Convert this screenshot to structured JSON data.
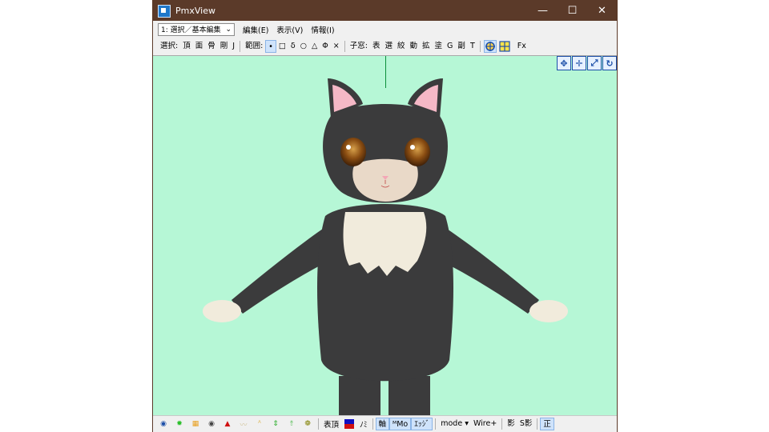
{
  "window": {
    "title": "PmxView",
    "minimize": "—",
    "maximize": "☐",
    "close": "✕"
  },
  "menubar": {
    "mode_value": "1: 選択／基本編集",
    "items": [
      "編集(E)",
      "表示(V)",
      "情報(I)"
    ]
  },
  "toolbar": {
    "select_label": "選択:",
    "select_items": [
      "頂",
      "面",
      "骨",
      "剛",
      "J"
    ],
    "range_label": "範囲:",
    "range_items": [
      "•",
      "□",
      "δ",
      "○",
      "△",
      "Φ",
      "×"
    ],
    "child_label": "子窓:",
    "child_items": [
      "表",
      "選",
      "絞",
      "動",
      "拡",
      "塗",
      "G",
      "副",
      "T"
    ],
    "fx_label": "Fx"
  },
  "statusbar": {
    "table_label": "表頂",
    "mi_label": "ﾉﾐ",
    "axis_label": "軸",
    "mo_label": "ᴹMo",
    "edge_label": "ｴｯｼﾞ",
    "mode_label": "mode ▾",
    "wire_label": "Wire+",
    "shadow_label": "影",
    "sshadow_label": "S影",
    "correct_label": "正"
  },
  "colors": {
    "titlebar": "#5b3a29",
    "viewport_bg": "#b6f7d6",
    "fur_dark": "#3b3b3c",
    "fur_light": "#f1ebdc",
    "ear_inner": "#f5b8c6",
    "eye_iris": "#8a4d12"
  }
}
